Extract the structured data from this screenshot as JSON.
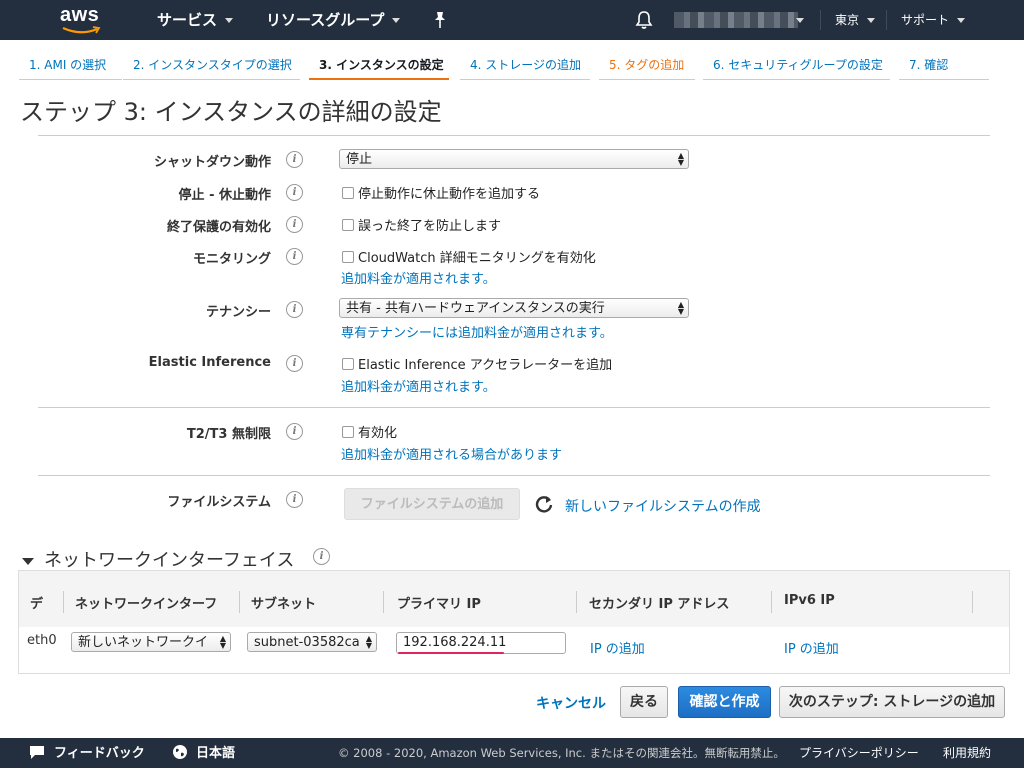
{
  "topnav": {
    "logo_text": "aws",
    "services": "サービス",
    "resource_groups": "リソースグループ",
    "region": "東京",
    "support": "サポート"
  },
  "wizard_tabs": [
    {
      "label": "1. AMI の選択"
    },
    {
      "label": "2. インスタンスタイプの選択"
    },
    {
      "label": "3. インスタンスの設定"
    },
    {
      "label": "4. ストレージの追加"
    },
    {
      "label": "5. タグの追加"
    },
    {
      "label": "6. セキュリティグループの設定"
    },
    {
      "label": "7. 確認"
    }
  ],
  "page_title": "ステップ 3: インスタンスの詳細の設定",
  "form": {
    "shutdown": {
      "label": "シャットダウン動作",
      "value": "停止"
    },
    "stop_hibernate": {
      "label": "停止 - 休止動作",
      "checkbox": "停止動作に休止動作を追加する"
    },
    "termination": {
      "label": "終了保護の有効化",
      "checkbox": "誤った終了を防止します"
    },
    "monitoring": {
      "label": "モニタリング",
      "checkbox": "CloudWatch 詳細モニタリングを有効化",
      "link": "追加料金が適用されます。"
    },
    "tenancy": {
      "label": "テナンシー",
      "value": "共有 - 共有ハードウェアインスタンスの実行",
      "link": "専有テナンシーには追加料金が適用されます。"
    },
    "elastic_inference": {
      "label": "Elastic Inference",
      "checkbox": "Elastic Inference アクセラレーターを追加",
      "link": "追加料金が適用されます。"
    },
    "t2t3": {
      "label": "T2/T3 無制限",
      "checkbox": "有効化",
      "link": "追加料金が適用される場合があります"
    },
    "filesystem": {
      "label": "ファイルシステム",
      "button": "ファイルシステムの追加",
      "link": "新しいファイルシステムの作成"
    }
  },
  "network": {
    "title": "ネットワークインターフェイス",
    "headers": [
      "デ",
      "ネットワークインターフ",
      "サブネット",
      "プライマリ IP",
      "セカンダリ IP アドレス",
      "IPv6 IP"
    ],
    "row": {
      "device": "eth0",
      "interface": "新しいネットワークイ",
      "subnet": "subnet-03582ca",
      "primary_ip": "192.168.224.11",
      "secondary_link": "IP の追加",
      "ipv6_link": "IP の追加"
    }
  },
  "actions": {
    "cancel": "キャンセル",
    "back": "戻る",
    "review": "確認と作成",
    "next": "次のステップ: ストレージの追加"
  },
  "footer": {
    "feedback": "フィードバック",
    "language": "日本語",
    "copyright": "© 2008 - 2020, Amazon Web Services, Inc. またはその関連会社。無断転用禁止。",
    "privacy": "プライバシーポリシー",
    "terms": "利用規約"
  }
}
